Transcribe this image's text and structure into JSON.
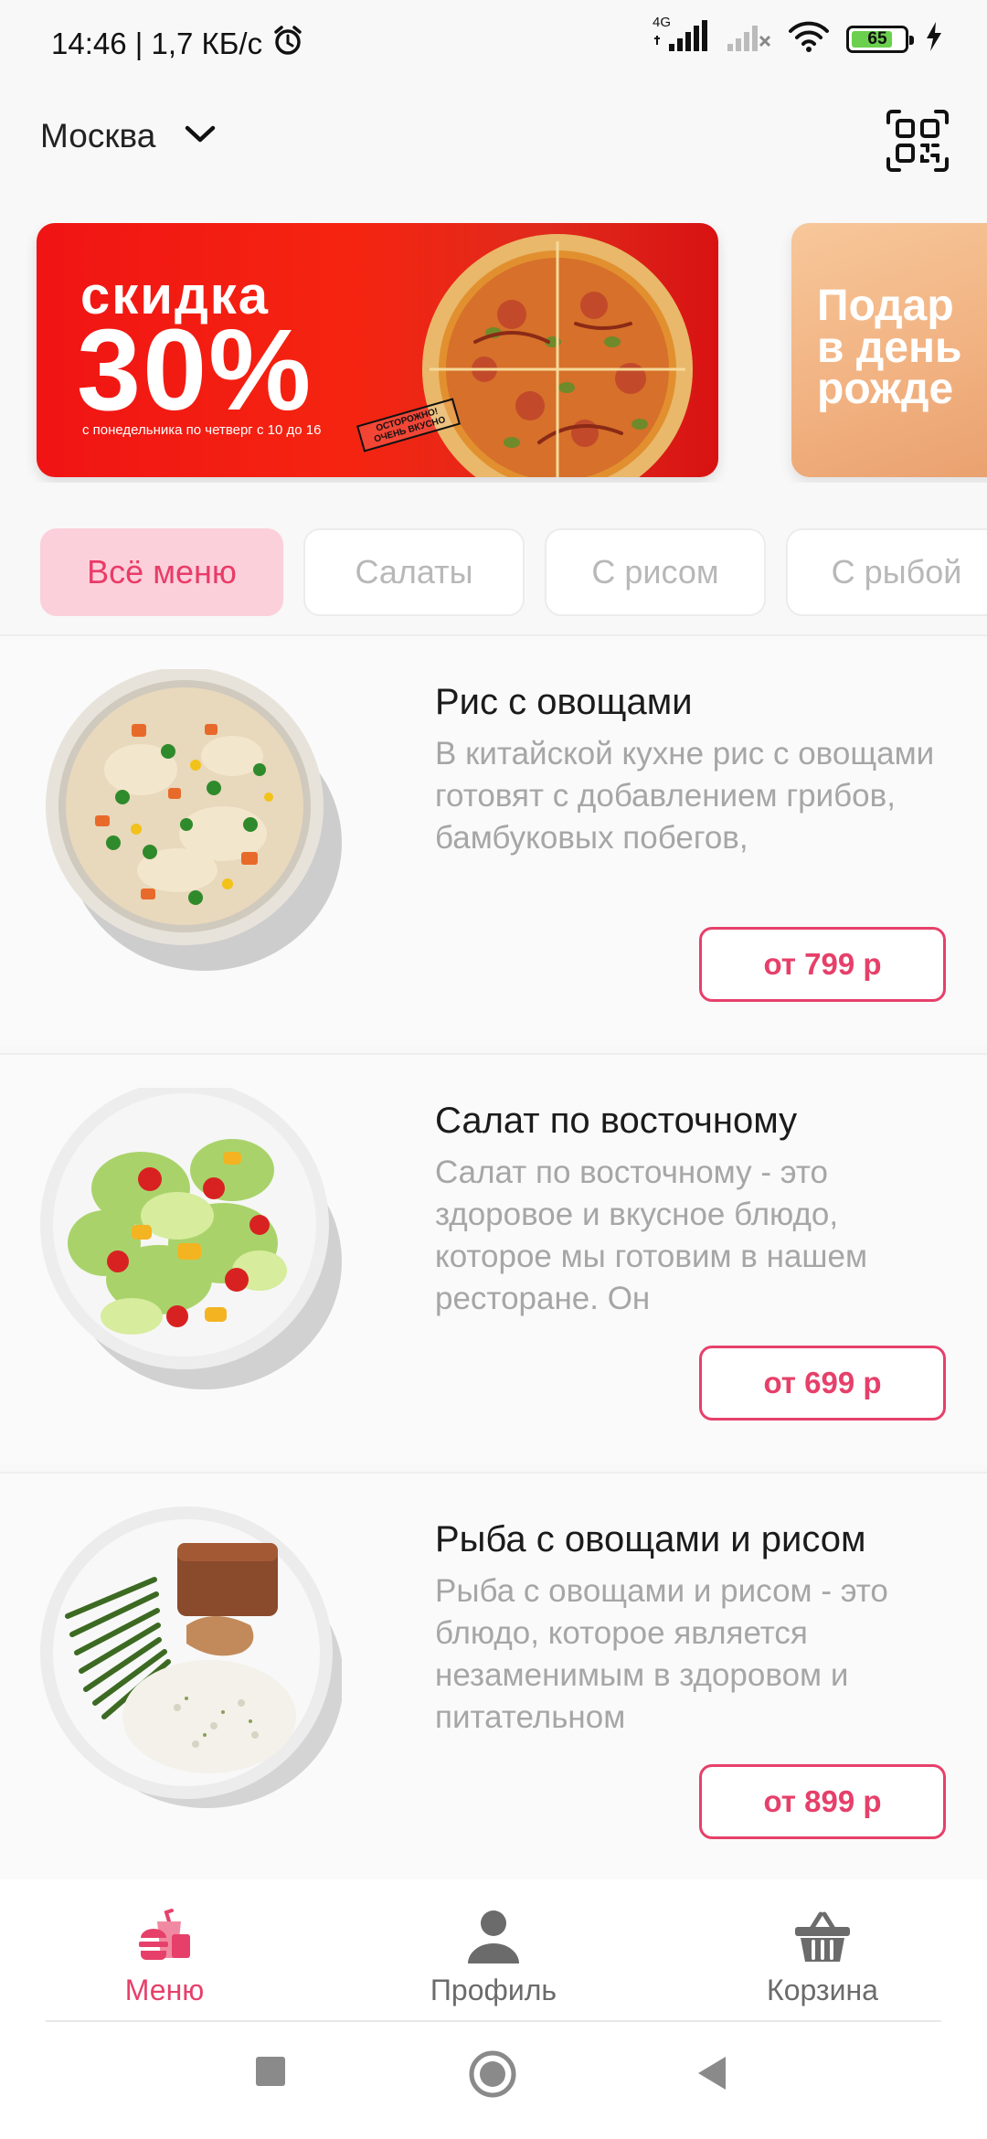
{
  "status_bar": {
    "time_and_speed": "14:46 | 1,7 КБ/с",
    "network_type": "4G",
    "battery_level": "65",
    "icons": [
      "alarm-icon",
      "signal-icon",
      "signal-no-sim-icon",
      "wifi-icon",
      "battery-icon",
      "charging-icon"
    ]
  },
  "header": {
    "city": "Москва",
    "icons": [
      "chevron-down-icon",
      "qr-scan-icon"
    ]
  },
  "banners": [
    {
      "title": "скидка",
      "big_text": "30%",
      "small_text": "с понедельника по четверг с 10 до 16",
      "stamp_line1": "ОСТОРОЖНО!",
      "stamp_line2": "ОЧЕНЬ ВКУСНО"
    },
    {
      "text": "Подар\nв день\nрожде"
    }
  ],
  "tabs": [
    {
      "label": "Всё меню",
      "active": true
    },
    {
      "label": "Салаты",
      "active": false
    },
    {
      "label": "С рисом",
      "active": false
    },
    {
      "label": "С рыбой",
      "active": false
    }
  ],
  "products": [
    {
      "name": "Рис с овощами",
      "description": "В китайской кухне рис с овощами готовят с добавлением грибов, бамбуковых побегов,",
      "price": "от 799 р"
    },
    {
      "name": "Салат по восточному",
      "description": "Салат по восточному - это здоровое и вкусное блюдо, которое мы готовим в нашем ресторане. Он",
      "price": "от 699 р"
    },
    {
      "name": "Рыба с овощами и рисом",
      "description": "Рыба с овощами и рисом - это блюдо, которое является незаменимым в здоровом и питательном",
      "price": "от 899 р"
    }
  ],
  "bottom_nav": [
    {
      "label": "Меню",
      "icon": "fastfood-icon",
      "active": true
    },
    {
      "label": "Профиль",
      "icon": "person-icon",
      "active": false
    },
    {
      "label": "Корзина",
      "icon": "basket-icon",
      "active": false
    }
  ],
  "colors": {
    "accent": "#e6406a",
    "active_tab_bg": "#fbd0da",
    "banner_red": "#f01414",
    "banner_peach": "#f1b07f",
    "muted_text": "#a6a6a6"
  }
}
